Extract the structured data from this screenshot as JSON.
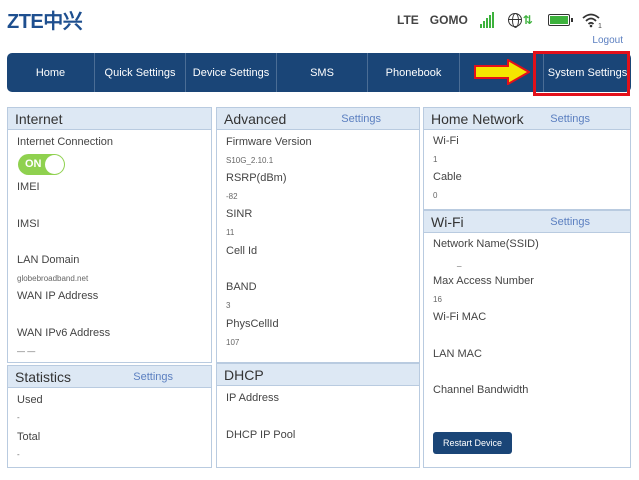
{
  "header": {
    "logo": "ZTE中兴",
    "network_type": "LTE",
    "operator": "GOMO",
    "wifi_clients": "1",
    "logout": "Logout",
    "signal_color": "#3db23d"
  },
  "nav": {
    "home": "Home",
    "quick_settings": "Quick Settings",
    "device_settings": "Device Settings",
    "sms": "SMS",
    "phonebook": "Phonebook",
    "system_settings": "System Settings",
    "highlight_color": "#e3101a",
    "arrow_color": "#f5e600"
  },
  "internet": {
    "title": "Internet",
    "connection_label": "Internet Connection",
    "toggle": "ON",
    "imei_label": "IMEI",
    "imsi_label": "IMSI",
    "lan_domain_label": "LAN Domain",
    "lan_domain_value": "globebroadband.net",
    "wan_ip_label": "WAN IP Address",
    "wan_ipv6_label": "WAN IPv6 Address",
    "wan_ipv6_value": "— —"
  },
  "statistics": {
    "title": "Statistics",
    "link": "Settings",
    "used_label": "Used",
    "used_value": "-",
    "total_label": "Total",
    "total_value": "-"
  },
  "advanced": {
    "title": "Advanced",
    "link": "Settings",
    "firmware_label": "Firmware Version",
    "firmware_value": "S10G_2.10.1",
    "rsrp_label": "RSRP(dBm)",
    "rsrp_value": "-82",
    "sinr_label": "SINR",
    "sinr_value": "11",
    "cell_id_label": "Cell Id",
    "band_label": "BAND",
    "band_value": "3",
    "physcell_label": "PhysCellId",
    "physcell_value": "107"
  },
  "dhcp": {
    "title": "DHCP",
    "ip_label": "IP Address",
    "pool_label": "DHCP IP Pool"
  },
  "home_network": {
    "title": "Home Network",
    "link": "Settings",
    "wifi_label": "Wi-Fi",
    "wifi_value": "1",
    "cable_label": "Cable",
    "cable_value": "0"
  },
  "wifi": {
    "title": "Wi-Fi",
    "link": "Settings",
    "ssid_label": "Network Name(SSID)",
    "ssid_value": "_",
    "max_access_label": "Max Access Number",
    "max_access_value": "16",
    "mac_label": "Wi-Fi MAC",
    "lan_mac_label": "LAN MAC",
    "bandwidth_label": "Channel Bandwidth",
    "restart_button": "Restart Device"
  }
}
